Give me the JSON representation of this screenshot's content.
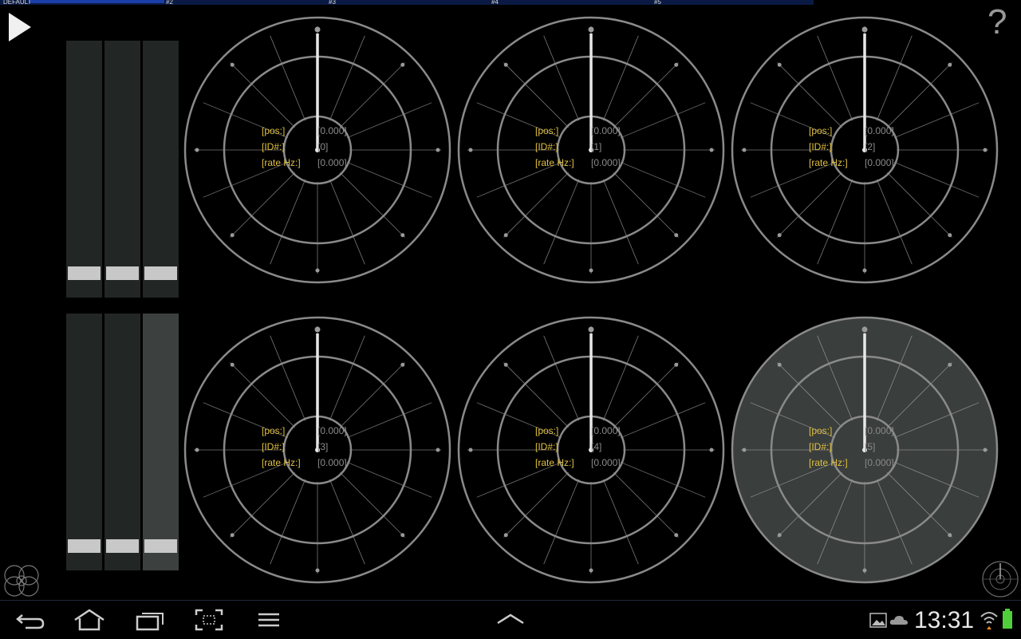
{
  "tabs": {
    "labels": [
      "DEFAULT",
      "#2",
      "#3",
      "#4",
      "#5"
    ],
    "active": "DEFAULT"
  },
  "toolbar": {
    "play_icon": "play-icon",
    "help_label": "?"
  },
  "faders": {
    "top": [
      {
        "id": "top-1",
        "level": 0.06
      },
      {
        "id": "top-2",
        "level": 0.06
      },
      {
        "id": "top-3",
        "level": 0.06
      }
    ],
    "bottom": [
      {
        "id": "bottom-1",
        "level": 0.06
      },
      {
        "id": "bottom-2",
        "level": 0.06
      },
      {
        "id": "bottom-3",
        "level": 0.06,
        "highlighted": true
      }
    ]
  },
  "dials": [
    {
      "pos_label": "[pos:]",
      "pos_value": "[0.000]",
      "id_label": "[ID#:]",
      "id_value": "[0]",
      "rate_label": "[rate Hz:]",
      "rate_value": "[0.000]",
      "active": false
    },
    {
      "pos_label": "[pos:]",
      "pos_value": "[0.000]",
      "id_label": "[ID#:]",
      "id_value": "[1]",
      "rate_label": "[rate Hz:]",
      "rate_value": "[0.000]",
      "active": false
    },
    {
      "pos_label": "[pos:]",
      "pos_value": "[0.000]",
      "id_label": "[ID#:]",
      "id_value": "[2]",
      "rate_label": "[rate Hz:]",
      "rate_value": "[0.000]",
      "active": false
    },
    {
      "pos_label": "[pos:]",
      "pos_value": "[0.000]",
      "id_label": "[ID#:]",
      "id_value": "[3]",
      "rate_label": "[rate Hz:]",
      "rate_value": "[0.000]",
      "active": false
    },
    {
      "pos_label": "[pos:]",
      "pos_value": "[0.000]",
      "id_label": "[ID#:]",
      "id_value": "[4]",
      "rate_label": "[rate Hz:]",
      "rate_value": "[0.000]",
      "active": false
    },
    {
      "pos_label": "[pos:]",
      "pos_value": "[0.000]",
      "id_label": "[ID#:]",
      "id_value": "[5]",
      "rate_label": "[rate Hz:]",
      "rate_value": "[0.000]",
      "active": true
    }
  ],
  "navbar": {
    "icons": [
      "back-icon",
      "home-icon",
      "recent-apps-icon",
      "screenshot-icon",
      "menu-icon",
      "up-arrow-icon"
    ],
    "status_icons": [
      "gallery-notification-icon",
      "cloud-notification-icon",
      "wifi-icon",
      "battery-icon"
    ],
    "clock": "13:31"
  },
  "colors": {
    "label_yellow": "#e0c040",
    "value_gray": "#8a8a8a",
    "active_dial_fill": "#3a3e3c",
    "tab_blue": "#1a3fa8"
  }
}
